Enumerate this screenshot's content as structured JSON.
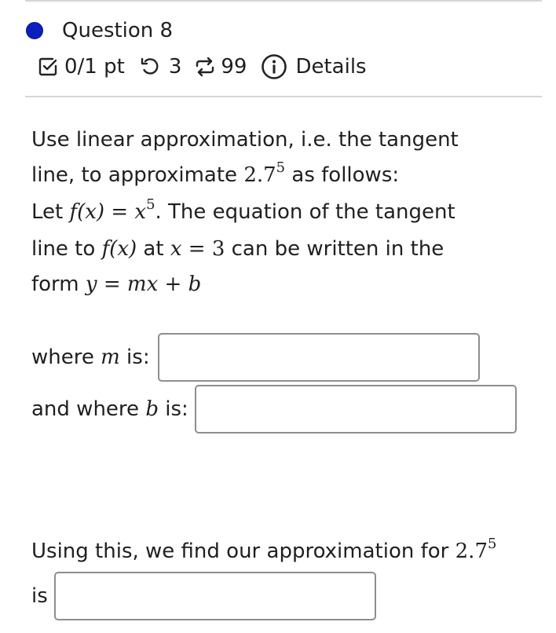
{
  "question": {
    "title": "Question 8",
    "status_color": "#0b1fbf",
    "meta": {
      "score": "0/1 pt",
      "retries": "3",
      "attempts": "99",
      "details_label": "Details",
      "icons": [
        "checkbox-icon",
        "undo-icon",
        "repeat-icon",
        "info-icon"
      ]
    }
  },
  "body": {
    "line1": "Use linear approximation, i.e. the tangent",
    "line2_pre": "line, to approximate",
    "base": "2.7",
    "exponent": "5",
    "line2_post": "as follows:",
    "line3_pre": "Let",
    "fx": "f(x)",
    "equals": "=",
    "x": "x",
    "line3_post": ". The equation of the tangent",
    "line4_pre": "line to",
    "line4_at": "at",
    "three": "3",
    "line4_post": "can be written in the",
    "line5_pre": "form",
    "y": "y",
    "mx": "mx",
    "plus": "+",
    "b": "b"
  },
  "answers": {
    "m_label_pre": "where",
    "m_var": "m",
    "m_label_post": "is:",
    "m_value": "",
    "b_label_pre": "and where",
    "b_var": "b",
    "b_label_post": "is:",
    "b_value": "",
    "final_text": "Using this, we find our approximation for",
    "final_base": "2.7",
    "final_exp": "5",
    "final_is": "is",
    "final_value": ""
  }
}
